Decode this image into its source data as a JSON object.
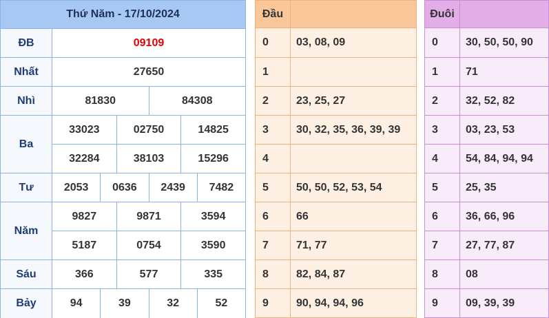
{
  "results": {
    "title": "Thứ Năm - 17/10/2024",
    "rows": [
      {
        "label": "ĐB",
        "lines": [
          [
            "09109"
          ]
        ],
        "special": true
      },
      {
        "label": "Nhất",
        "lines": [
          [
            "27650"
          ]
        ]
      },
      {
        "label": "Nhì",
        "lines": [
          [
            "81830",
            "84308"
          ]
        ]
      },
      {
        "label": "Ba",
        "lines": [
          [
            "33023",
            "02750",
            "14825"
          ],
          [
            "32284",
            "38103",
            "15296"
          ]
        ]
      },
      {
        "label": "Tư",
        "lines": [
          [
            "2053",
            "0636",
            "2439",
            "7482"
          ]
        ]
      },
      {
        "label": "Năm",
        "lines": [
          [
            "9827",
            "9871",
            "3594"
          ],
          [
            "5187",
            "0754",
            "3590"
          ]
        ]
      },
      {
        "label": "Sáu",
        "lines": [
          [
            "366",
            "577",
            "335"
          ]
        ]
      },
      {
        "label": "Bảy",
        "lines": [
          [
            "94",
            "39",
            "32",
            "52"
          ]
        ]
      }
    ]
  },
  "dau": {
    "header": "Đầu",
    "rows": [
      {
        "digit": "0",
        "values": "03, 08, 09"
      },
      {
        "digit": "1",
        "values": ""
      },
      {
        "digit": "2",
        "values": "23, 25, 27"
      },
      {
        "digit": "3",
        "values": "30, 32, 35, 36, 39, 39"
      },
      {
        "digit": "4",
        "values": ""
      },
      {
        "digit": "5",
        "values": "50, 50, 52, 53, 54"
      },
      {
        "digit": "6",
        "values": "66"
      },
      {
        "digit": "7",
        "values": "71, 77"
      },
      {
        "digit": "8",
        "values": "82, 84, 87"
      },
      {
        "digit": "9",
        "values": "90, 94, 94, 96"
      }
    ]
  },
  "duoi": {
    "header": "Đuôi",
    "rows": [
      {
        "digit": "0",
        "values": "30, 50, 50, 90"
      },
      {
        "digit": "1",
        "values": "71"
      },
      {
        "digit": "2",
        "values": "32, 52, 82"
      },
      {
        "digit": "3",
        "values": "03, 23, 53"
      },
      {
        "digit": "4",
        "values": "54, 84, 94, 94"
      },
      {
        "digit": "5",
        "values": "25, 35"
      },
      {
        "digit": "6",
        "values": "36, 66, 96"
      },
      {
        "digit": "7",
        "values": "27, 77, 87"
      },
      {
        "digit": "8",
        "values": "08"
      },
      {
        "digit": "9",
        "values": "09, 39, 39"
      }
    ]
  }
}
